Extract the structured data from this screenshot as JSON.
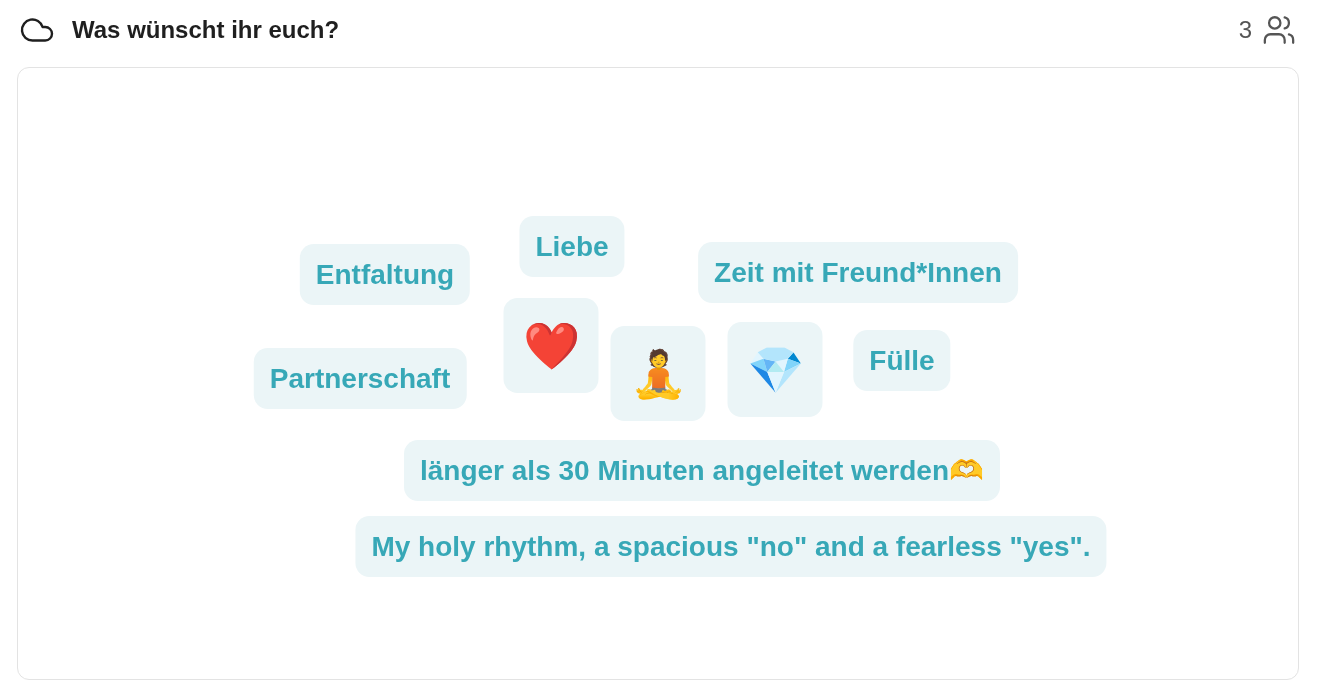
{
  "header": {
    "title": "Was wünscht ihr euch?",
    "participants": "3"
  },
  "word_cloud": {
    "items": [
      {
        "kind": "word",
        "text": "Entfaltung"
      },
      {
        "kind": "word",
        "text": "Liebe"
      },
      {
        "kind": "word",
        "text": "Zeit mit Freund*Innen"
      },
      {
        "kind": "word",
        "text": "Partnerschaft"
      },
      {
        "kind": "emoji",
        "text": "❤️"
      },
      {
        "kind": "emoji",
        "text": "🧘"
      },
      {
        "kind": "emoji",
        "text": "💎"
      },
      {
        "kind": "word",
        "text": "Fülle"
      },
      {
        "kind": "word",
        "text": "länger als 30 Minuten angeleitet werden🫶"
      },
      {
        "kind": "word",
        "text": "My holy rhythm, a spacious \"no\" and a fearless \"yes\"."
      }
    ]
  }
}
